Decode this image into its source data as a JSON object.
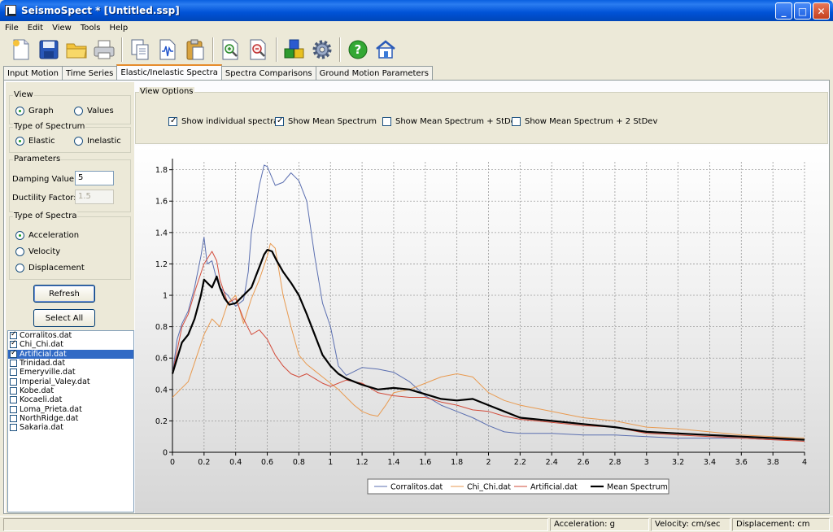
{
  "window": {
    "title": "SeismoSpect * [Untitled.ssp]",
    "minimize": "_",
    "maximize": "□",
    "close": "✕"
  },
  "menu": [
    "File",
    "Edit",
    "View",
    "Tools",
    "Help"
  ],
  "toolbar_icons": [
    "new-file-icon",
    "save-icon",
    "open-folder-icon",
    "print-icon",
    "copy-icon",
    "waveform-icon",
    "paste-icon",
    "zoom-in-icon",
    "zoom-out-icon",
    "cubes-icon",
    "gear-icon",
    "help-icon",
    "home-icon"
  ],
  "tabs": [
    "Input Motion",
    "Time Series",
    "Elastic/Inelastic Spectra",
    "Spectra Comparisons",
    "Ground Motion Parameters"
  ],
  "left": {
    "view": {
      "title": "View",
      "options": [
        "Graph",
        "Values"
      ],
      "selected": "Graph"
    },
    "spectrum_type": {
      "title": "Type of Spectrum",
      "options": [
        "Elastic",
        "Inelastic"
      ],
      "selected": "Elastic"
    },
    "parameters": {
      "title": "Parameters",
      "damping_label": "Damping Value:",
      "damping_value": "5",
      "ductility_label": "Ductility Factor:",
      "ductility_value": "1.5"
    },
    "spectra_type": {
      "title": "Type of Spectra",
      "options": [
        "Acceleration",
        "Velocity",
        "Displacement"
      ],
      "selected": "Acceleration"
    },
    "refresh": "Refresh",
    "select_all": "Select All",
    "files": [
      {
        "name": "Corralitos.dat",
        "checked": true
      },
      {
        "name": "Chi_Chi.dat",
        "checked": true
      },
      {
        "name": "Artificial.dat",
        "checked": true,
        "selected": true
      },
      {
        "name": "Trinidad.dat",
        "checked": false
      },
      {
        "name": "Emeryville.dat",
        "checked": false
      },
      {
        "name": "Imperial_Valey.dat",
        "checked": false
      },
      {
        "name": "Kobe.dat",
        "checked": false
      },
      {
        "name": "Kocaeli.dat",
        "checked": false
      },
      {
        "name": "Loma_Prieta.dat",
        "checked": false
      },
      {
        "name": "NorthRidge.dat",
        "checked": false
      },
      {
        "name": "Sakaria.dat",
        "checked": false
      }
    ]
  },
  "view_options": {
    "title": "View Options",
    "items": [
      {
        "label": "Show individual spectra",
        "checked": true
      },
      {
        "label": "Show Mean Spectrum",
        "checked": true
      },
      {
        "label": "Show Mean Spectrum + StDev",
        "checked": false
      },
      {
        "label": "Show Mean Spectrum + 2 StDev",
        "checked": false
      }
    ]
  },
  "chart_data": {
    "type": "line",
    "xlim": [
      0,
      4
    ],
    "ylim": [
      0,
      1.85
    ],
    "x_ticks": [
      "0",
      "0.2",
      "0.4",
      "0.6",
      "0.8",
      "1",
      "1.2",
      "1.4",
      "1.6",
      "1.8",
      "2",
      "2.2",
      "2.4",
      "2.6",
      "2.8",
      "3",
      "3.2",
      "3.4",
      "3.6",
      "3.8",
      "4"
    ],
    "y_ticks": [
      "0",
      "0.2",
      "0.4",
      "0.6",
      "0.8",
      "1",
      "1.2",
      "1.4",
      "1.6",
      "1.8"
    ],
    "grid": true,
    "legend_position": "bottom",
    "series": [
      {
        "name": "Corralitos.dat",
        "color": "#5b6fb0",
        "width": 1,
        "x": [
          0,
          0.03,
          0.06,
          0.1,
          0.14,
          0.18,
          0.2,
          0.22,
          0.25,
          0.28,
          0.3,
          0.35,
          0.4,
          0.45,
          0.48,
          0.5,
          0.55,
          0.58,
          0.6,
          0.65,
          0.7,
          0.75,
          0.8,
          0.85,
          0.9,
          0.95,
          1.0,
          1.05,
          1.1,
          1.2,
          1.3,
          1.4,
          1.5,
          1.6,
          1.7,
          1.8,
          1.9,
          2.0,
          2.1,
          2.2,
          2.4,
          2.6,
          2.8,
          3.0,
          3.2,
          3.4,
          3.6,
          3.8,
          4.0
        ],
        "y": [
          0.5,
          0.72,
          0.82,
          0.9,
          1.05,
          1.25,
          1.37,
          1.2,
          1.22,
          1.1,
          1.05,
          1.0,
          0.93,
          0.97,
          1.15,
          1.4,
          1.7,
          1.83,
          1.82,
          1.7,
          1.72,
          1.78,
          1.73,
          1.6,
          1.25,
          0.95,
          0.8,
          0.55,
          0.49,
          0.54,
          0.53,
          0.51,
          0.45,
          0.36,
          0.3,
          0.26,
          0.22,
          0.17,
          0.13,
          0.12,
          0.12,
          0.11,
          0.11,
          0.1,
          0.09,
          0.09,
          0.09,
          0.08,
          0.08
        ]
      },
      {
        "name": "Chi_Chi.dat",
        "color": "#e89a50",
        "width": 1,
        "x": [
          0,
          0.05,
          0.1,
          0.15,
          0.2,
          0.25,
          0.3,
          0.35,
          0.4,
          0.45,
          0.5,
          0.55,
          0.6,
          0.62,
          0.65,
          0.7,
          0.75,
          0.8,
          0.85,
          0.9,
          0.95,
          1.0,
          1.05,
          1.1,
          1.15,
          1.2,
          1.25,
          1.3,
          1.35,
          1.4,
          1.5,
          1.6,
          1.7,
          1.8,
          1.9,
          2.0,
          2.1,
          2.2,
          2.4,
          2.6,
          2.8,
          3.0,
          3.2,
          3.4,
          3.6,
          3.8,
          4.0
        ],
        "y": [
          0.35,
          0.4,
          0.45,
          0.6,
          0.75,
          0.85,
          0.8,
          0.95,
          1.0,
          0.82,
          0.98,
          1.1,
          1.25,
          1.33,
          1.3,
          1.0,
          0.8,
          0.62,
          0.56,
          0.52,
          0.48,
          0.44,
          0.4,
          0.35,
          0.3,
          0.26,
          0.24,
          0.23,
          0.3,
          0.38,
          0.4,
          0.44,
          0.48,
          0.5,
          0.48,
          0.38,
          0.33,
          0.3,
          0.26,
          0.22,
          0.2,
          0.16,
          0.15,
          0.13,
          0.11,
          0.1,
          0.09
        ]
      },
      {
        "name": "Artificial.dat",
        "color": "#d24b3a",
        "width": 1,
        "x": [
          0,
          0.03,
          0.06,
          0.1,
          0.15,
          0.2,
          0.25,
          0.28,
          0.3,
          0.35,
          0.4,
          0.45,
          0.5,
          0.55,
          0.6,
          0.65,
          0.7,
          0.75,
          0.8,
          0.85,
          0.9,
          0.95,
          1.0,
          1.1,
          1.2,
          1.3,
          1.4,
          1.5,
          1.6,
          1.7,
          1.8,
          1.9,
          2.0,
          2.1,
          2.2,
          2.4,
          2.6,
          2.8,
          3.0,
          3.2,
          3.4,
          3.6,
          3.8,
          4.0
        ],
        "y": [
          0.5,
          0.65,
          0.8,
          0.88,
          1.05,
          1.2,
          1.28,
          1.22,
          1.1,
          0.95,
          0.98,
          0.85,
          0.75,
          0.78,
          0.72,
          0.62,
          0.55,
          0.5,
          0.48,
          0.5,
          0.47,
          0.44,
          0.42,
          0.46,
          0.44,
          0.38,
          0.36,
          0.35,
          0.35,
          0.32,
          0.3,
          0.27,
          0.26,
          0.23,
          0.21,
          0.19,
          0.17,
          0.16,
          0.12,
          0.11,
          0.1,
          0.09,
          0.08,
          0.07
        ]
      },
      {
        "name": "Mean Spectrum",
        "color": "#000000",
        "width": 2.2,
        "x": [
          0,
          0.03,
          0.06,
          0.1,
          0.14,
          0.18,
          0.2,
          0.22,
          0.25,
          0.28,
          0.3,
          0.33,
          0.36,
          0.4,
          0.45,
          0.5,
          0.55,
          0.58,
          0.6,
          0.63,
          0.66,
          0.7,
          0.75,
          0.8,
          0.85,
          0.9,
          0.95,
          1.0,
          1.05,
          1.1,
          1.15,
          1.2,
          1.3,
          1.4,
          1.5,
          1.6,
          1.7,
          1.8,
          1.9,
          2.0,
          2.1,
          2.2,
          2.4,
          2.6,
          2.8,
          3.0,
          3.2,
          3.4,
          3.6,
          3.8,
          4.0
        ],
        "y": [
          0.5,
          0.6,
          0.7,
          0.75,
          0.85,
          1.0,
          1.1,
          1.08,
          1.05,
          1.12,
          1.05,
          0.98,
          0.94,
          0.95,
          1.0,
          1.05,
          1.18,
          1.26,
          1.29,
          1.28,
          1.22,
          1.15,
          1.08,
          1.0,
          0.88,
          0.75,
          0.62,
          0.55,
          0.5,
          0.47,
          0.45,
          0.43,
          0.4,
          0.41,
          0.4,
          0.37,
          0.34,
          0.33,
          0.34,
          0.3,
          0.26,
          0.22,
          0.2,
          0.18,
          0.16,
          0.13,
          0.12,
          0.11,
          0.1,
          0.09,
          0.08
        ]
      }
    ]
  },
  "status": {
    "empty": "",
    "acceleration": "Acceleration: g",
    "velocity": "Velocity: cm/sec",
    "displacement": "Displacement: cm"
  }
}
